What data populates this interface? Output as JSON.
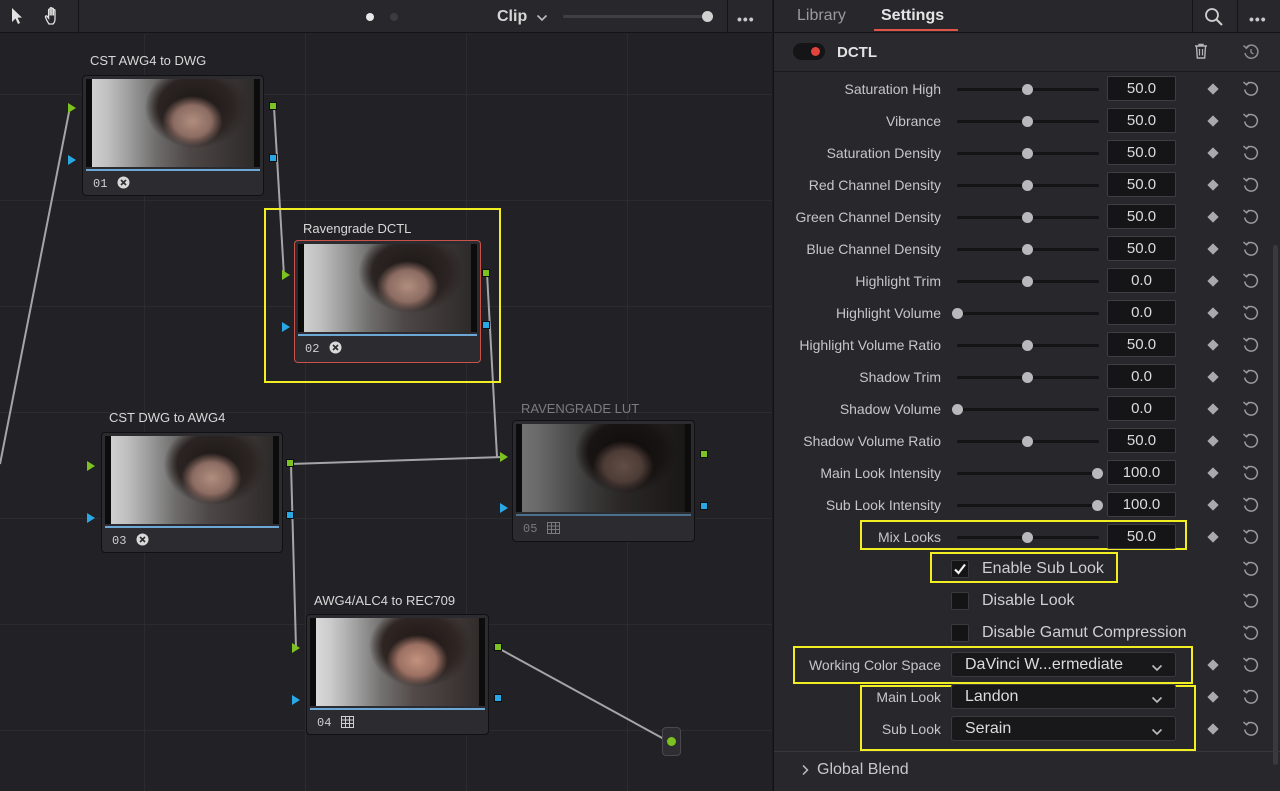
{
  "node_toolbar": {
    "clip_label": "Clip",
    "icons": [
      "pointer-icon",
      "hand-icon",
      "more-icon"
    ]
  },
  "nodes": [
    {
      "id": "01",
      "label": "CST AWG4 to DWG",
      "icon": "fx-icon"
    },
    {
      "id": "02",
      "label": "Ravengrade DCTL",
      "icon": "fx-icon",
      "selected": true
    },
    {
      "id": "03",
      "label": "CST DWG to AWG4",
      "icon": "fx-icon"
    },
    {
      "id": "05",
      "label": "RAVENGRADE LUT",
      "icon": "lut-grid-icon",
      "disabled": true
    },
    {
      "id": "04",
      "label": "AWG4/ALC4 to REC709",
      "icon": "lut-grid-icon"
    }
  ],
  "inspector": {
    "tabs": [
      {
        "label": "Library",
        "active": false
      },
      {
        "label": "Settings",
        "active": true
      }
    ],
    "title": "DCTL",
    "enabled_color": "#e3433a",
    "params": [
      {
        "label": "Saturation High",
        "value": "50.0",
        "pos": 0.5
      },
      {
        "label": "Vibrance",
        "value": "50.0",
        "pos": 0.5
      },
      {
        "label": "Saturation Density",
        "value": "50.0",
        "pos": 0.5
      },
      {
        "label": "Red Channel Density",
        "value": "50.0",
        "pos": 0.5
      },
      {
        "label": "Green Channel Density",
        "value": "50.0",
        "pos": 0.5
      },
      {
        "label": "Blue Channel Density",
        "value": "50.0",
        "pos": 0.5
      },
      {
        "label": "Highlight Trim",
        "value": "0.0",
        "pos": 0.5
      },
      {
        "label": "Highlight Volume",
        "value": "0.0",
        "pos": 0.0
      },
      {
        "label": "Highlight Volume Ratio",
        "value": "50.0",
        "pos": 0.5
      },
      {
        "label": "Shadow Trim",
        "value": "0.0",
        "pos": 0.5
      },
      {
        "label": "Shadow Volume",
        "value": "0.0",
        "pos": 0.0
      },
      {
        "label": "Shadow Volume Ratio",
        "value": "50.0",
        "pos": 0.5
      },
      {
        "label": "Main Look Intensity",
        "value": "100.0",
        "pos": 1.0
      },
      {
        "label": "Sub Look Intensity",
        "value": "100.0",
        "pos": 1.0
      },
      {
        "label": "Mix Looks",
        "value": "50.0",
        "pos": 0.5
      }
    ],
    "checkboxes": [
      {
        "label": "Enable Sub Look",
        "checked": true
      },
      {
        "label": "Disable Look",
        "checked": false
      },
      {
        "label": "Disable Gamut Compression",
        "checked": false
      }
    ],
    "dropdowns": [
      {
        "label": "Working Color Space",
        "value": "DaVinci W...ermediate"
      },
      {
        "label": "Main Look",
        "value": "Landon"
      },
      {
        "label": "Sub Look",
        "value": "Serain"
      }
    ],
    "global_blend": "Global Blend"
  },
  "colors": {
    "highlight": "#f1ee22",
    "rgb_port": "#7cc221",
    "alpha_port": "#29a8e6",
    "accent": "#e05547"
  }
}
